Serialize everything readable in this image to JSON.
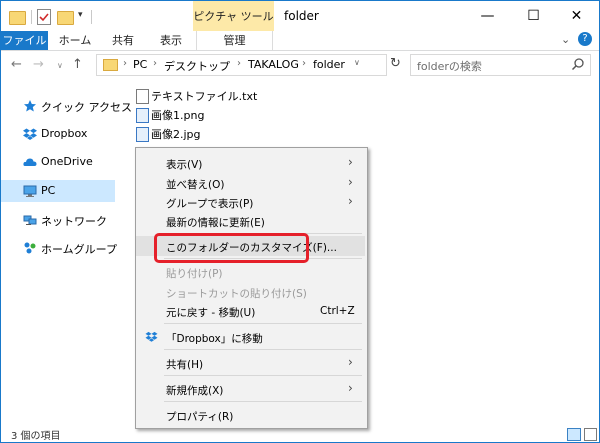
{
  "window": {
    "title": "folder",
    "context_tab": "ピクチャ ツール",
    "controls": {
      "minimize": "—",
      "maximize": "☐",
      "close": "✕"
    }
  },
  "ribbon": {
    "tabs": [
      "ファイル",
      "ホーム",
      "共有",
      "表示",
      "管理"
    ],
    "help_chevron": "⌄",
    "help_q": "?"
  },
  "nav": {
    "back": "←",
    "forward": "→",
    "up": "↑",
    "dropdown": "∨",
    "refresh": "↻"
  },
  "address": {
    "breadcrumbs": [
      "PC",
      "デスクトップ",
      "TAKALOG",
      "folder"
    ],
    "separator": "›"
  },
  "search": {
    "placeholder": "folderの検索"
  },
  "sidebar": {
    "items": [
      {
        "label": "クイック アクセス",
        "icon": "star-icon"
      },
      {
        "label": "Dropbox",
        "icon": "dropbox-icon"
      },
      {
        "label": "OneDrive",
        "icon": "cloud-icon"
      },
      {
        "label": "PC",
        "icon": "computer-icon",
        "selected": true
      },
      {
        "label": "ネットワーク",
        "icon": "network-icon"
      },
      {
        "label": "ホームグループ",
        "icon": "homegroup-icon"
      }
    ]
  },
  "files": [
    {
      "name": "テキストファイル.txt",
      "icon": "text-file-icon"
    },
    {
      "name": "画像1.png",
      "icon": "image-file-icon"
    },
    {
      "name": "画像2.jpg",
      "icon": "image-file-icon"
    }
  ],
  "context_menu": {
    "items": [
      {
        "label": "表示(V)",
        "submenu": true
      },
      {
        "label": "並べ替え(O)",
        "submenu": true
      },
      {
        "label": "グループで表示(P)",
        "submenu": true
      },
      {
        "label": "最新の情報に更新(E)"
      },
      {
        "label": "このフォルダーのカスタマイズ(F)...",
        "highlighted": true
      },
      {
        "label": "貼り付け(P)",
        "disabled": true
      },
      {
        "label": "ショートカットの貼り付け(S)",
        "disabled": true
      },
      {
        "label": "元に戻す - 移動(U)",
        "shortcut": "Ctrl+Z"
      },
      {
        "label": "「Dropbox」に移動",
        "icon": "dropbox-icon"
      },
      {
        "label": "共有(H)",
        "submenu": true
      },
      {
        "label": "新規作成(X)",
        "submenu": true
      },
      {
        "label": "プロパティ(R)"
      }
    ],
    "submenu_arrow": "›"
  },
  "status": {
    "item_count": "3 個の項目"
  },
  "colors": {
    "accent": "#1979ca",
    "picture_tools_tab": "#fde9a8",
    "selected_nav": "#cce8ff",
    "highlight_box": "#e5202a",
    "menu_bg": "#f2f2f2"
  }
}
